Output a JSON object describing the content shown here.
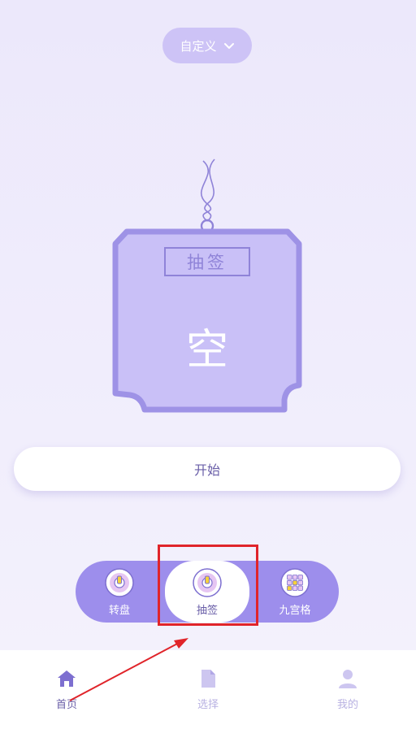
{
  "header": {
    "mode_label": "自定义"
  },
  "tag": {
    "title": "抽签",
    "result": "空"
  },
  "start_label": "开始",
  "modes": [
    {
      "label": "转盘",
      "icon": "dial-icon",
      "active": false
    },
    {
      "label": "抽签",
      "icon": "dial-icon",
      "active": true
    },
    {
      "label": "九宫格",
      "icon": "grid-icon",
      "active": false
    }
  ],
  "tabbar": [
    {
      "label": "首页",
      "icon": "home-icon",
      "active": true
    },
    {
      "label": "选择",
      "icon": "document-icon",
      "active": false
    },
    {
      "label": "我的",
      "icon": "user-icon",
      "active": false
    }
  ],
  "colors": {
    "accent": "#9d8eec",
    "tag_fill": "#c9c0f7",
    "tag_border": "#9e92e6",
    "highlight": "#e0242a"
  }
}
